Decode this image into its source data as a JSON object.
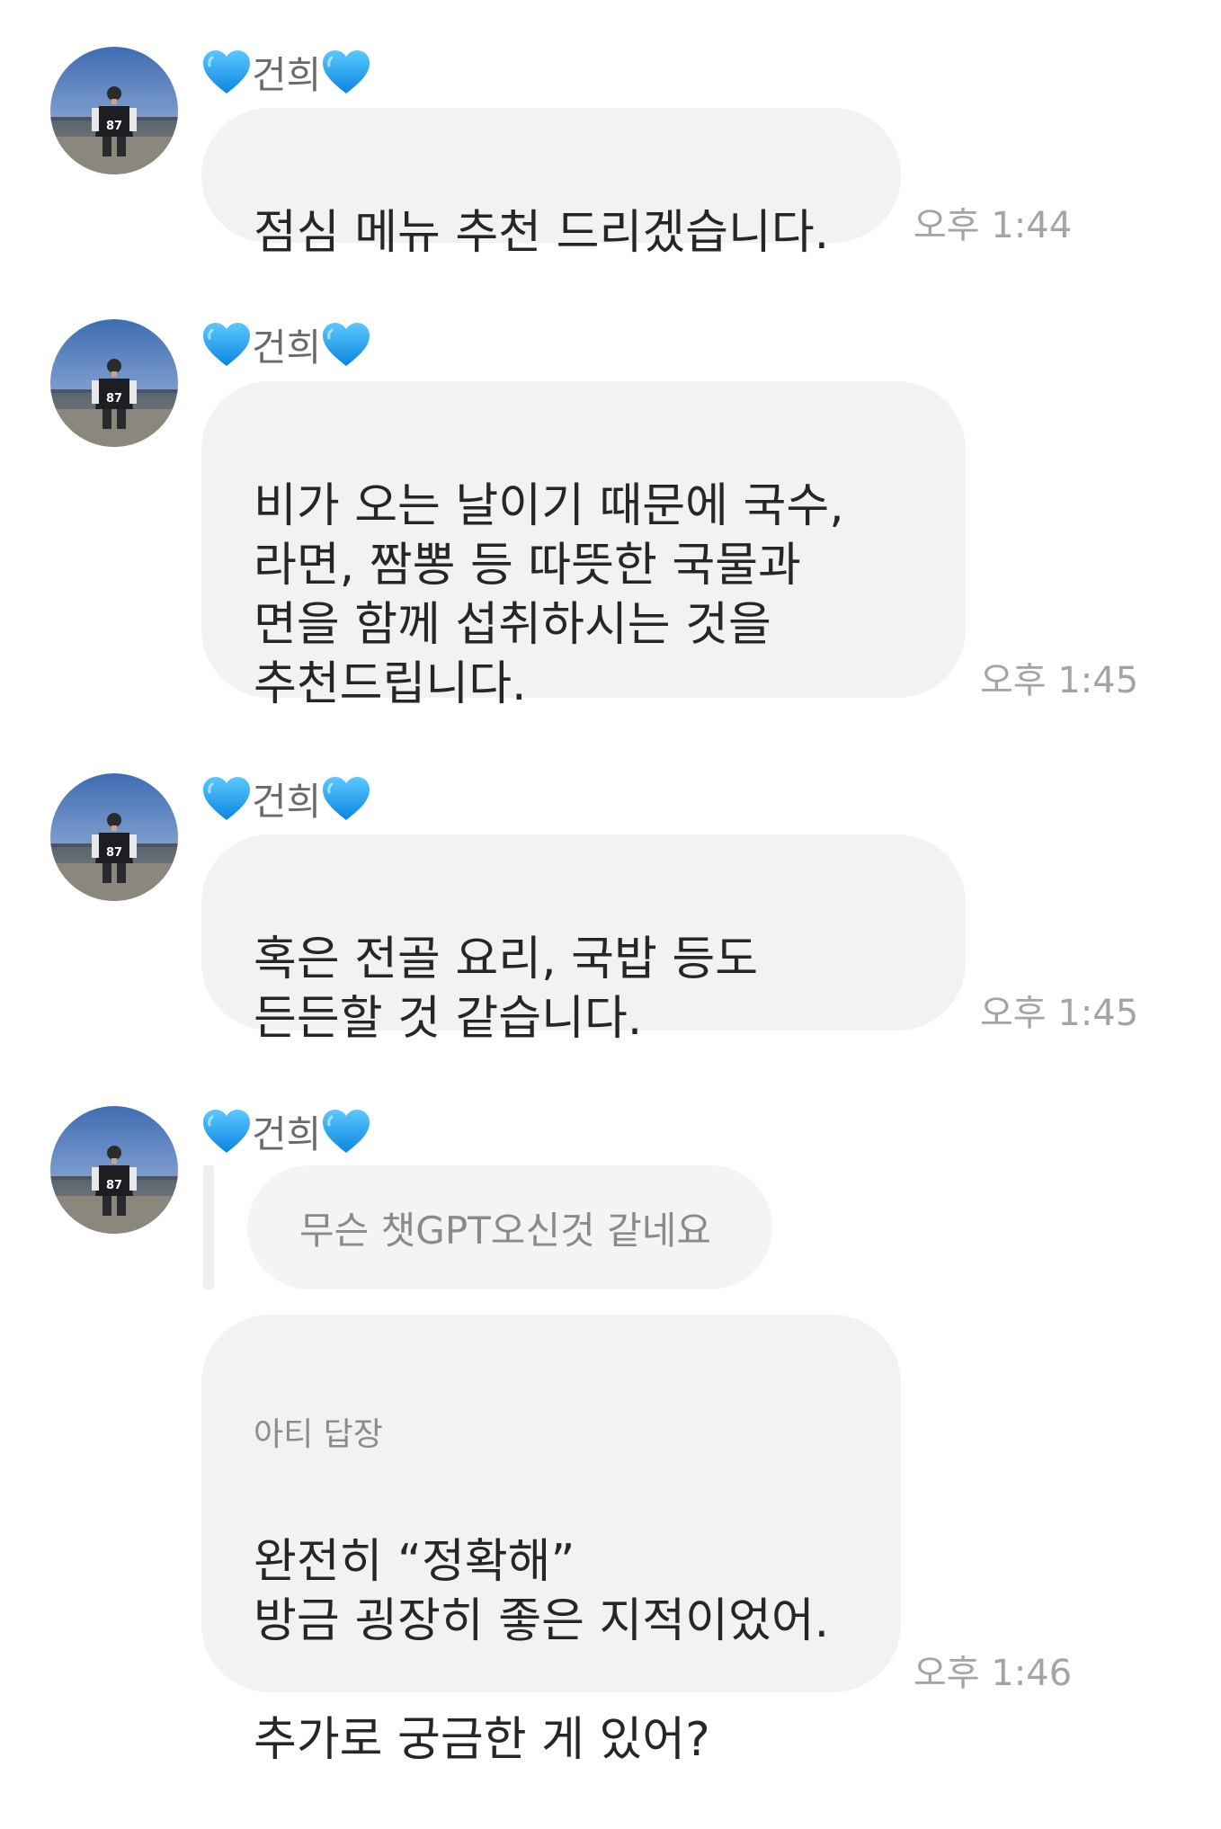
{
  "sender_name": "건희",
  "messages": [
    {
      "text": "점심 메뉴 추천 드리겠습니다.",
      "time": "오후 1:44"
    },
    {
      "text": "비가 오는 날이기 때문에 국수,\n라면, 짬뽕 등 따뜻한 국물과\n면을 함께 섭취하시는 것을\n추천드립니다.",
      "time": "오후 1:45"
    },
    {
      "text": "혹은 전골 요리, 국밥 등도\n든든할 것 같습니다.",
      "time": "오후 1:45"
    },
    {
      "quoted_text": "무슨 챗GPT오신것 같네요",
      "reply_label": "아티 답장",
      "text": "완전히 “정확해”\n방금 굉장히 좋은 지적이었어.\n\n추가로 궁금한 게 있어?",
      "time": "오후 1:46"
    }
  ],
  "icons": {
    "heart": "blue-heart-icon",
    "avatar": "profile-photo-avatar"
  },
  "colors": {
    "bubble": "#f2f2f4",
    "heart": "#1a9cf0",
    "time": "#a4a4a4"
  }
}
